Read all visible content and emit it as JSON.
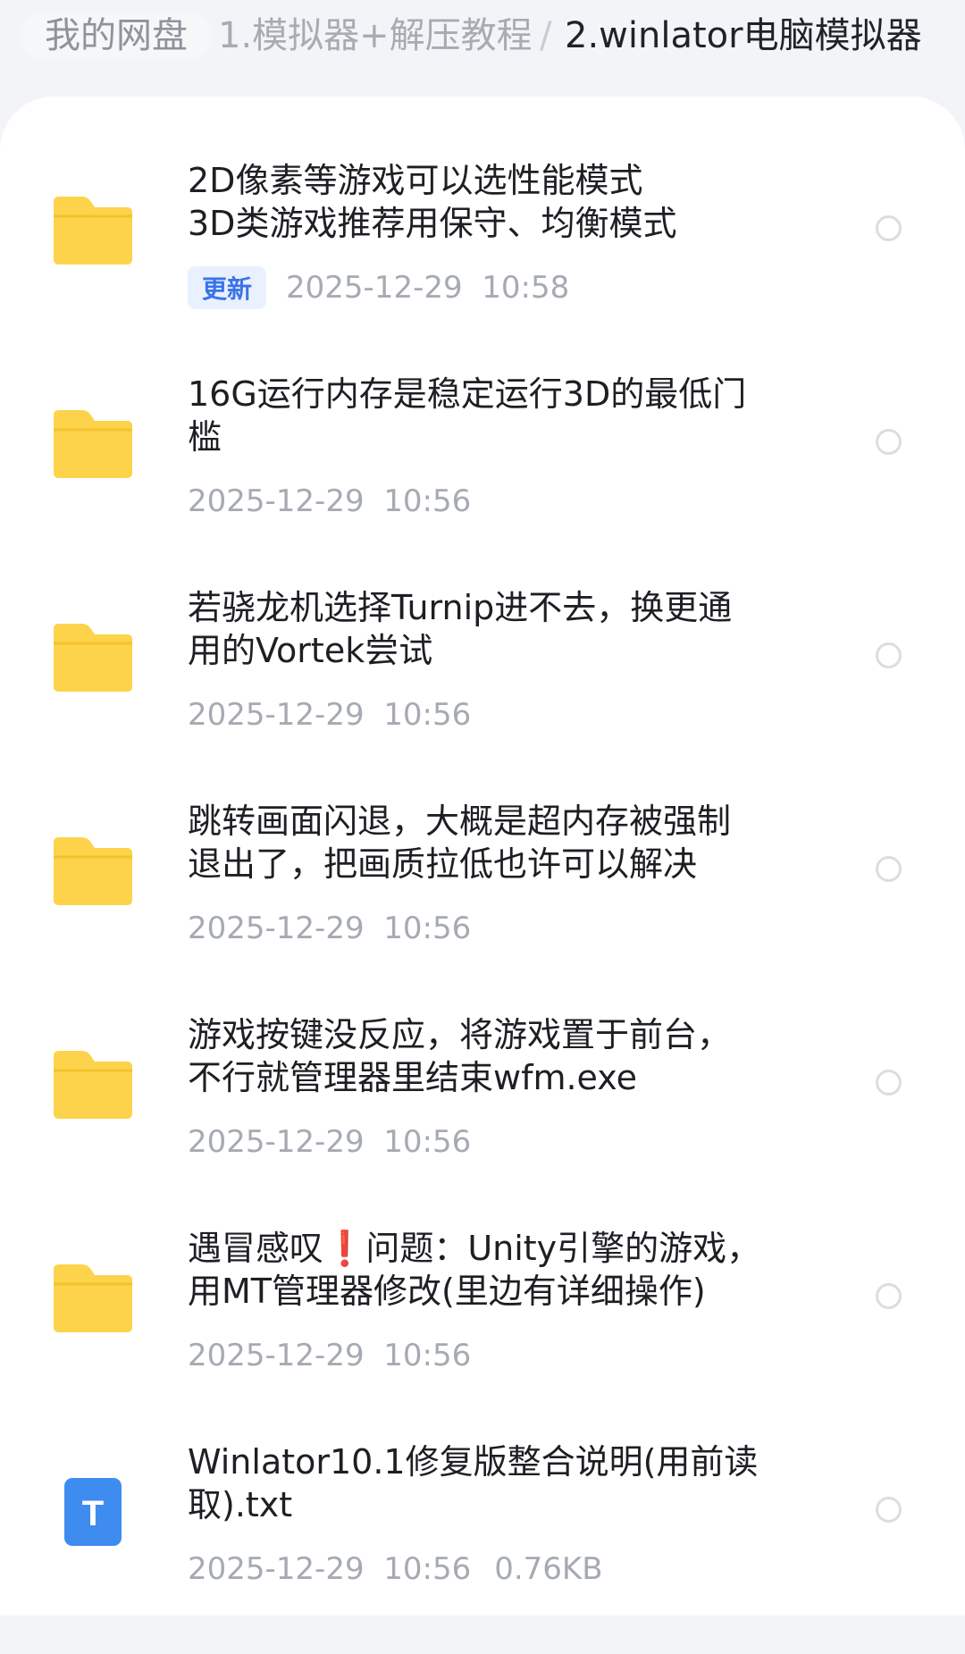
{
  "breadcrumb": {
    "root": "我的网盘",
    "parent": "1.模拟器+解压教程",
    "separator": "/",
    "current": "2.winlator电脑模拟器"
  },
  "colors": {
    "folder": "#fcd34a",
    "txt_file": "#3f8cf0",
    "badge_text": "#3b74e8"
  },
  "files": [
    {
      "icon": "folder-icon",
      "title": "2D像素等游戏可以选性能模式\n3D类游戏推荐用保守、均衡模式",
      "badge": "更新",
      "date": "2025-12-29",
      "time": "10:58"
    },
    {
      "icon": "folder-icon",
      "title": "16G运行内存是稳定运行3D的最低门\n槛",
      "date": "2025-12-29",
      "time": "10:56"
    },
    {
      "icon": "folder-icon",
      "title": "若骁龙机选择Turnip进不去，换更通\n用的Vortek尝试",
      "date": "2025-12-29",
      "time": "10:56"
    },
    {
      "icon": "folder-icon",
      "title": "跳转画面闪退，大概是超内存被强制\n退出了，把画质拉低也许可以解决",
      "date": "2025-12-29",
      "time": "10:56"
    },
    {
      "icon": "folder-icon",
      "title": "游戏按键没反应，将游戏置于前台，\n不行就管理器里结束wfm.exe",
      "date": "2025-12-29",
      "time": "10:56"
    },
    {
      "icon": "folder-icon",
      "title": "遇冒感叹❗问题：Unity引擎的游戏，\n用MT管理器修改(里边有详细操作)",
      "date": "2025-12-29",
      "time": "10:56"
    },
    {
      "icon": "txt-file-icon",
      "icon_letter": "T",
      "title": "Winlator10.1修复版整合说明(用前读\n取).txt",
      "date": "2025-12-29",
      "time": "10:56",
      "size": "0.76KB"
    }
  ]
}
